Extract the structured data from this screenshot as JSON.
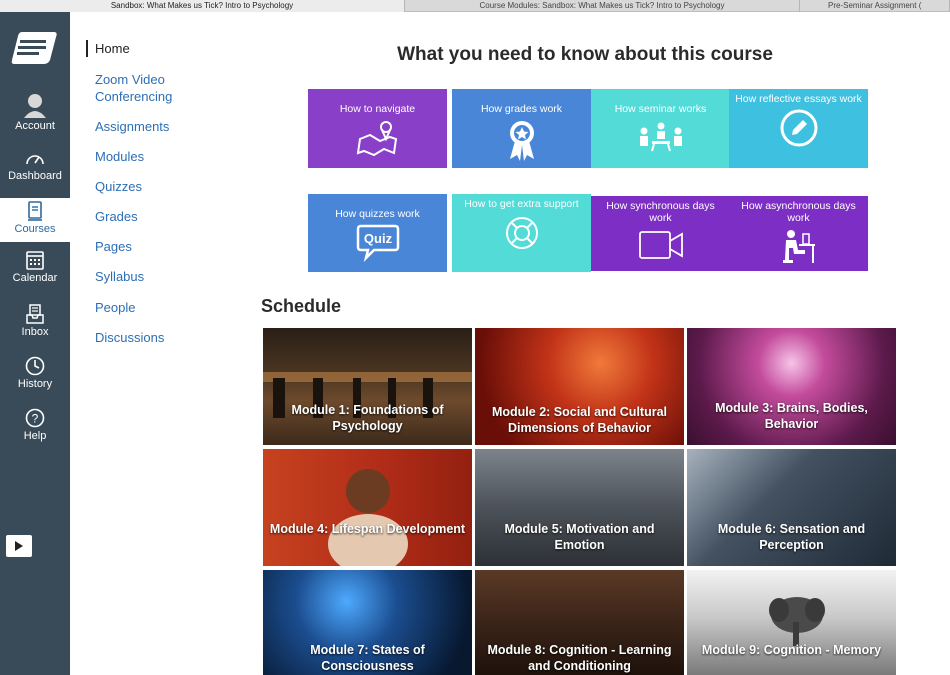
{
  "browser": {
    "tabs": [
      {
        "label": "Sandbox: What Makes us Tick? Intro to Psychology",
        "active": true
      },
      {
        "label": "Course Modules: Sandbox: What Makes us Tick? Intro to Psychology",
        "active": false
      },
      {
        "label": "Pre-Seminar Assignment (",
        "active": false
      }
    ]
  },
  "global_nav": {
    "items": [
      {
        "label": "Account",
        "icon": "account-icon"
      },
      {
        "label": "Dashboard",
        "icon": "dashboard-icon"
      },
      {
        "label": "Courses",
        "icon": "courses-icon",
        "active": true
      },
      {
        "label": "Calendar",
        "icon": "calendar-icon"
      },
      {
        "label": "Inbox",
        "icon": "inbox-icon"
      },
      {
        "label": "History",
        "icon": "history-icon"
      },
      {
        "label": "Help",
        "icon": "help-icon"
      }
    ]
  },
  "course_nav": {
    "items": [
      {
        "label": "Home",
        "active": true
      },
      {
        "label": "Zoom Video Conferencing"
      },
      {
        "label": "Assignments"
      },
      {
        "label": "Modules"
      },
      {
        "label": "Quizzes"
      },
      {
        "label": "Grades"
      },
      {
        "label": "Pages"
      },
      {
        "label": "Syllabus"
      },
      {
        "label": "People"
      },
      {
        "label": "Discussions"
      }
    ]
  },
  "main": {
    "title": "What you need to know about this course",
    "tiles": [
      {
        "label": "How to navigate",
        "icon": "map-pin-icon",
        "color": "#8a3fc9"
      },
      {
        "label": "How grades work",
        "icon": "award-ribbon-icon",
        "color": "#4a86d8"
      },
      {
        "label": "How seminar works",
        "icon": "seminar-group-icon",
        "color": "#53dbd8"
      },
      {
        "label": "How reflective essays work",
        "icon": "pencil-circle-icon",
        "color": "#3ec0e0"
      },
      {
        "label": "How quizzes work",
        "icon": "quiz-bubble-icon",
        "quiz_text": "Quiz",
        "color": "#4a86d8"
      },
      {
        "label": "How to get extra support",
        "icon": "lifebuoy-icon",
        "color": "#53dbd8"
      },
      {
        "label": "How synchronous days work",
        "icon": "video-camera-icon",
        "color": "#7d2fc5"
      },
      {
        "label": "How asynchronous days work",
        "icon": "person-at-desk-icon",
        "color": "#7d2fc5"
      }
    ],
    "schedule_heading": "Schedule",
    "modules": [
      {
        "label": "Module 1: Foundations of Psychology",
        "bg": "#3b2a1c"
      },
      {
        "label": "Module 2: Social and Cultural Dimensions of Behavior",
        "bg": "#8a1a10"
      },
      {
        "label": "Module 3: Brains, Bodies, Behavior",
        "bg": "#7a2c63"
      },
      {
        "label": "Module 4: Lifespan Development",
        "bg": "#b8331f"
      },
      {
        "label": "Module 5: Motivation and Emotion",
        "bg": "#5a5f66"
      },
      {
        "label": "Module 6: Sensation and Perception",
        "bg": "#4a5561"
      },
      {
        "label": "Module 7: States of Consciousness",
        "bg": "#0f2c52"
      },
      {
        "label": "Module 8: Cognition - Learning and Conditioning",
        "bg": "#3a2418"
      },
      {
        "label": "Module 9: Cognition - Memory",
        "bg": "#9a9a9a"
      }
    ]
  }
}
